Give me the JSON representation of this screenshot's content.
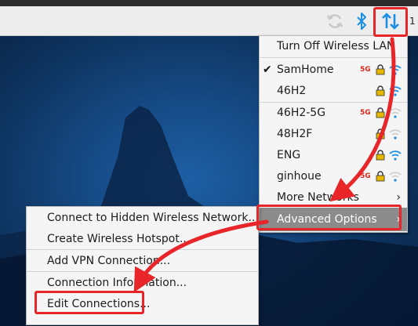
{
  "clock_partial": "1",
  "network_menu": {
    "items": [
      {
        "label": "Turn Off Wireless LAN"
      },
      {
        "label": "SamHome",
        "connected": true,
        "band": "5G",
        "secured": true,
        "signal": "strong"
      },
      {
        "label": "46H2",
        "band": "",
        "secured": true,
        "signal": "strong"
      },
      {
        "label": "46H2-5G",
        "band": "5G",
        "secured": true,
        "signal": "weak"
      },
      {
        "label": "48H2F",
        "band": "",
        "secured": true,
        "signal": "weak"
      },
      {
        "label": "ENG",
        "band": "",
        "secured": true,
        "signal": "strong"
      },
      {
        "label": "ginhoue",
        "band": "5G",
        "secured": true,
        "signal": "weak"
      },
      {
        "label": "More Networks",
        "submenu": true
      },
      {
        "label": "Advanced Options",
        "submenu": true,
        "highlighted": true
      }
    ],
    "check_mark": "✔",
    "chevron": "›"
  },
  "advanced_menu": {
    "items": [
      {
        "label": "Connect to Hidden Wireless Network..."
      },
      {
        "label": "Create Wireless Hotspot..."
      },
      {
        "label": "Add VPN Connection..."
      },
      {
        "label": "Connection Information..."
      },
      {
        "label": "Edit Connections..."
      }
    ]
  },
  "colors": {
    "accent_blue": "#1a8fe3",
    "annotation_red": "#e8262a",
    "badge_red": "#d9261c",
    "lock_yellow": "#e6b800",
    "highlight_gray": "#8b8b8b"
  },
  "icons": [
    "sync-icon",
    "bluetooth-icon",
    "network-transfer-icon",
    "checkmark-icon",
    "lock-icon",
    "wifi-icon",
    "chevron-right-icon"
  ]
}
